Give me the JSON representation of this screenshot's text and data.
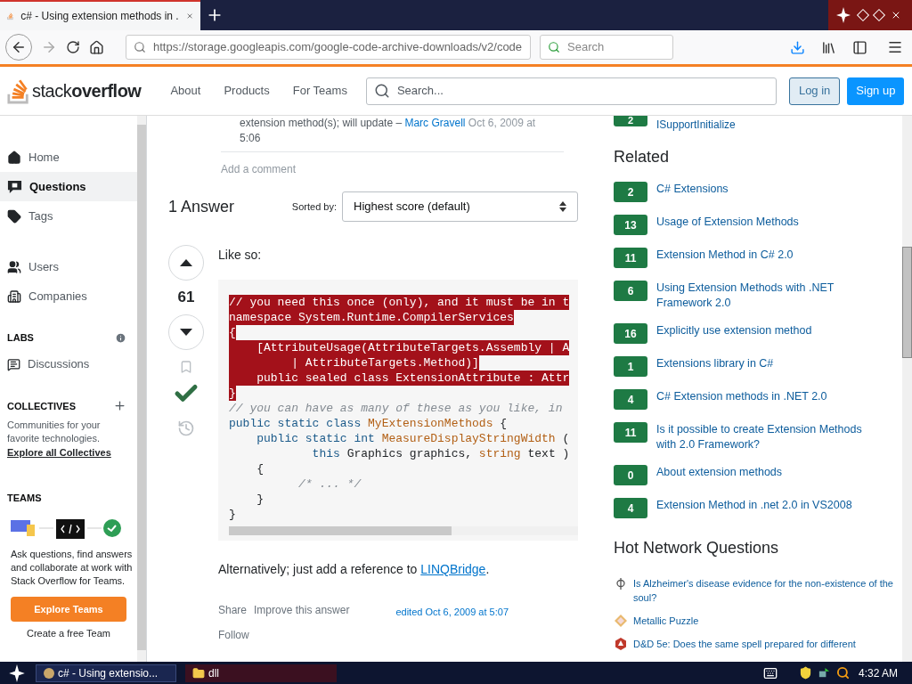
{
  "browser": {
    "tab_title": "c# - Using extension methods in .",
    "url": "https://storage.googleapis.com/google-code-archive-downloads/v2/code",
    "search_placeholder": "Search"
  },
  "header": {
    "logo_light": "stack",
    "logo_bold": "overflow",
    "nav": [
      "About",
      "Products",
      "For Teams"
    ],
    "search_placeholder": "Search...",
    "login": "Log in",
    "signup": "Sign up"
  },
  "left_nav": [
    {
      "kind": "home",
      "label": "Home",
      "selected": false
    },
    {
      "kind": "questions",
      "label": "Questions",
      "selected": true
    },
    {
      "kind": "tags",
      "label": "Tags",
      "selected": false
    },
    {
      "kind": "users",
      "label": "Users",
      "selected": false
    },
    {
      "kind": "companies",
      "label": "Companies",
      "selected": false
    }
  ],
  "labs": {
    "heading": "LABS",
    "item": "Discussions"
  },
  "collectives": {
    "heading": "COLLECTIVES",
    "text": "Communities for your favorite technologies.",
    "link": "Explore all Collectives"
  },
  "teams": {
    "heading": "TEAMS",
    "text": "Ask questions, find answers and collaborate at work with Stack Overflow for Teams.",
    "button": "Explore Teams",
    "link": "Create a free Team"
  },
  "comment": {
    "text": "extension method(s); will update –",
    "author": "Marc Gravell",
    "date": "Oct 6, 2009 at",
    "time": "5:06"
  },
  "add_comment": "Add a comment",
  "answers_heading": "1 Answer",
  "sort": {
    "label": "Sorted by:",
    "value": "Highest score (default)"
  },
  "answer": {
    "score": "61",
    "accepted": true,
    "intro": "Like so:",
    "code": [
      {
        "selected": true,
        "segments": [
          {
            "kind": "plain",
            "text": "// you need this once (only), and it must be in t"
          }
        ]
      },
      {
        "selected": true,
        "segments": [
          {
            "kind": "plain",
            "text": "namespace System.Runtime.CompilerServices"
          }
        ]
      },
      {
        "selected": true,
        "segments": [
          {
            "kind": "plain",
            "text": "{"
          }
        ]
      },
      {
        "selected": true,
        "segments": [
          {
            "kind": "plain",
            "text": "    [AttributeUsage(AttributeTargets.Assembly | A"
          }
        ]
      },
      {
        "selected": true,
        "segments": [
          {
            "kind": "plain",
            "text": "         | AttributeTargets.Method)]"
          }
        ]
      },
      {
        "selected": true,
        "segments": [
          {
            "kind": "plain",
            "text": "    public sealed class ExtensionAttribute : Attr"
          }
        ]
      },
      {
        "selected": true,
        "segments": [
          {
            "kind": "plain",
            "text": "}"
          }
        ]
      },
      {
        "selected": false,
        "segments": [
          {
            "kind": "comment",
            "text": "// you can have as many of these as you like, in"
          }
        ]
      },
      {
        "selected": false,
        "segments": [
          {
            "kind": "keyword",
            "text": "public static class "
          },
          {
            "kind": "type",
            "text": "MyExtensionMethods"
          },
          {
            "kind": "plain",
            "text": " {"
          }
        ]
      },
      {
        "selected": false,
        "segments": [
          {
            "kind": "keyword",
            "text": "    public static int "
          },
          {
            "kind": "type",
            "text": "MeasureDisplayStringWidth"
          },
          {
            "kind": "plain",
            "text": " ("
          }
        ]
      },
      {
        "selected": false,
        "segments": [
          {
            "kind": "keyword",
            "text": "            this "
          },
          {
            "kind": "plain",
            "text": "Graphics graphics, "
          },
          {
            "kind": "type",
            "text": "string"
          },
          {
            "kind": "plain",
            "text": " text )"
          }
        ]
      },
      {
        "selected": false,
        "segments": [
          {
            "kind": "plain",
            "text": "    {"
          }
        ]
      },
      {
        "selected": false,
        "segments": [
          {
            "kind": "comment",
            "text": "          /* ... */"
          }
        ]
      },
      {
        "selected": false,
        "segments": [
          {
            "kind": "plain",
            "text": "    }"
          }
        ]
      },
      {
        "selected": false,
        "segments": [
          {
            "kind": "plain",
            "text": "}"
          }
        ]
      }
    ],
    "after_text": "Alternatively; just add a reference to ",
    "after_link": "LINQBridge",
    "after_end": ".",
    "actions": [
      "Share",
      "Improve this answer",
      "Follow"
    ],
    "edited": "edited Oct 6, 2009 at 5:07"
  },
  "linked_tail": {
    "score": "2",
    "title": "ISupportInitialize"
  },
  "related": {
    "heading": "Related",
    "items": [
      {
        "score": "2",
        "title": "C# Extensions"
      },
      {
        "score": "13",
        "title": "Usage of Extension Methods"
      },
      {
        "score": "11",
        "title": "Extension Method in C# 2.0"
      },
      {
        "score": "6",
        "title": "Using Extension Methods with .NET Framework 2.0"
      },
      {
        "score": "16",
        "title": "Explicitly use extension method"
      },
      {
        "score": "1",
        "title": "Extensions library in C#"
      },
      {
        "score": "4",
        "title": "C# Extension methods in .NET 2.0"
      },
      {
        "score": "11",
        "title": "Is it possible to create Extension Methods with 2.0 Framework?"
      },
      {
        "score": "0",
        "title": "About extension methods"
      },
      {
        "score": "4",
        "title": "Extension Method in .net 2.0 in VS2008"
      }
    ]
  },
  "hot": {
    "heading": "Hot Network Questions",
    "items": [
      {
        "kind": "philosophy",
        "title": "Is Alzheimer's disease evidence for the non-existence of the soul?"
      },
      {
        "kind": "puzzling",
        "title": "Metallic Puzzle"
      },
      {
        "kind": "rpg",
        "title": "D&D 5e: Does the same spell prepared for different"
      }
    ]
  },
  "taskbar": {
    "window": "c# - Using extensio...",
    "folder": "dll",
    "clock": "4:32 AM"
  }
}
